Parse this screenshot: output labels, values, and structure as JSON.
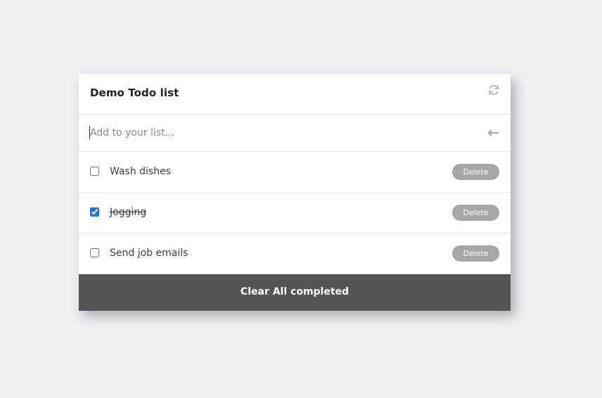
{
  "header": {
    "title": "Demo Todo list",
    "refresh_icon": "refresh-icon"
  },
  "add": {
    "placeholder": "Add to your list...",
    "value": "",
    "submit_icon": "arrow-left-icon"
  },
  "items": [
    {
      "label": "Wash dishes",
      "checked": false,
      "delete_label": "Delete"
    },
    {
      "label": "Jogging",
      "checked": true,
      "delete_label": "Delete"
    },
    {
      "label": "Send job emails",
      "checked": false,
      "delete_label": "Delete"
    }
  ],
  "footer": {
    "clear_label": "Clear All completed"
  },
  "colors": {
    "background": "#eff0f4",
    "delete_button": "#a6a6a6",
    "footer": "#545454",
    "checkbox_accent": "#1a73e8"
  }
}
